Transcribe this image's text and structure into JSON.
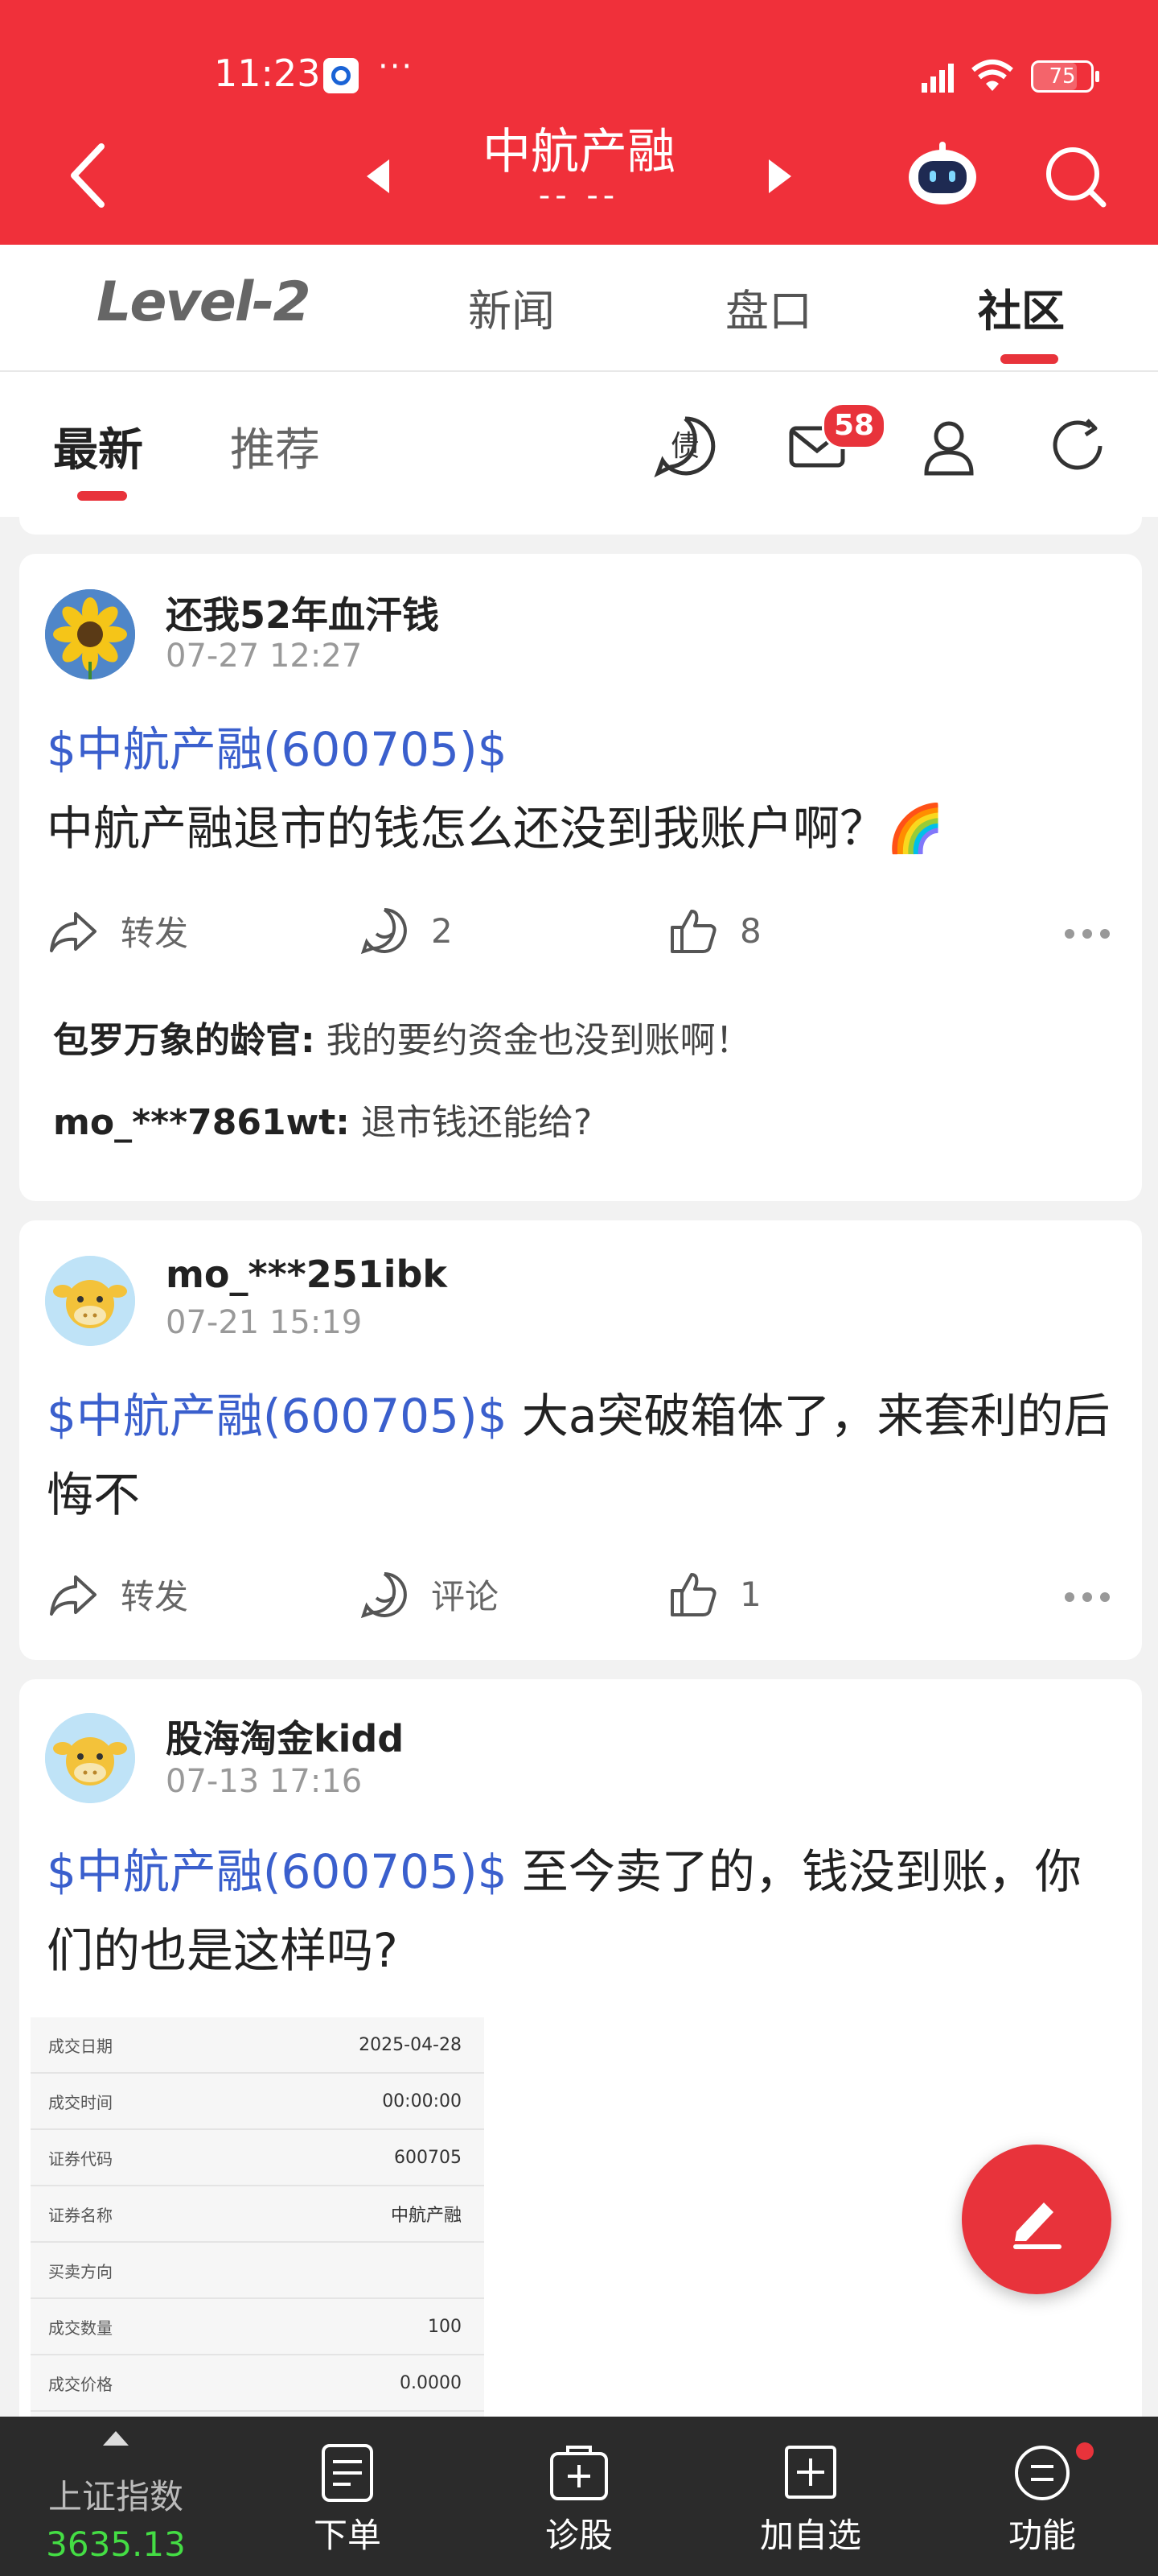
{
  "status_bar": {
    "time": "11:23",
    "dots": "···",
    "battery": "75"
  },
  "header": {
    "title": "中航产融",
    "subtitle": "-- --"
  },
  "tabs": [
    {
      "label": "Level-2"
    },
    {
      "label": "新闻"
    },
    {
      "label": "盘口"
    },
    {
      "label": "社区"
    }
  ],
  "subtabs": [
    {
      "label": "最新"
    },
    {
      "label": "推荐"
    }
  ],
  "icons": {
    "bond_label": "债",
    "message_badge": "58"
  },
  "posts": [
    {
      "username": "还我52年血汗钱",
      "time": "07-27 12:27",
      "stock": "$中航产融(600705)$",
      "text": "中航产融退市的钱怎么还没到我账户啊？🌈",
      "share": "转发",
      "comments": "2",
      "likes": "8",
      "replies": [
        {
          "user": "包罗万象的龄官:",
          "text": "我的要约资金也没到账啊！"
        },
        {
          "user": "mo_***7861wt:",
          "text": "退市钱还能给?"
        }
      ]
    },
    {
      "username": "mo_***251ibk",
      "time": "07-21 15:19",
      "stock": "$中航产融(600705)$",
      "text": " 大a突破箱体了，来套利的后悔不",
      "share": "转发",
      "comments": "评论",
      "likes": "1"
    },
    {
      "username": "股海淘金kidd",
      "time": "07-13 17:16",
      "stock": "$中航产融(600705)$",
      "text": " 至今卖了的，钱没到账，你们的也是这样吗?",
      "receipt": [
        {
          "k": "成交日期",
          "v": "2025-04-28"
        },
        {
          "k": "成交时间",
          "v": "00:00:00"
        },
        {
          "k": "证券代码",
          "v": "600705"
        },
        {
          "k": "证券名称",
          "v": "中航产融"
        },
        {
          "k": "买卖方向",
          "v": ""
        },
        {
          "k": "成交数量",
          "v": "100"
        },
        {
          "k": "成交价格",
          "v": "0.0000"
        }
      ]
    }
  ],
  "bottom_nav": {
    "index_name": "上证指数",
    "index_value": "3635.13",
    "items": [
      "下单",
      "诊股",
      "加自选",
      "功能"
    ]
  },
  "colors": {
    "brand_red": "#f0303a",
    "link_blue": "#3a5fcd",
    "index_green": "#44dd44"
  }
}
